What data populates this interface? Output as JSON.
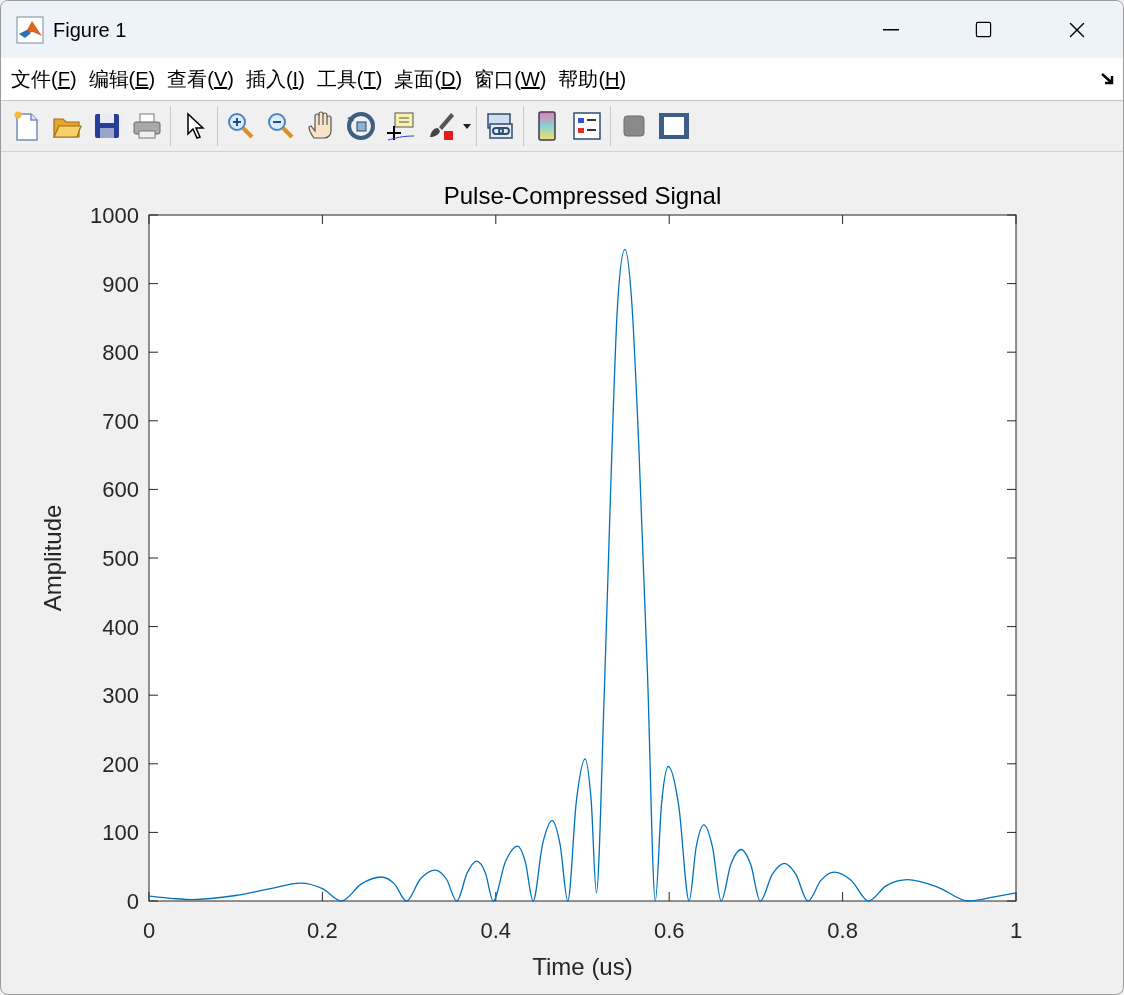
{
  "window": {
    "title": "Figure 1"
  },
  "menu": [
    {
      "label": "文件(F)"
    },
    {
      "label": "编辑(E)"
    },
    {
      "label": "查看(V)"
    },
    {
      "label": "插入(I)"
    },
    {
      "label": "工具(T)"
    },
    {
      "label": "桌面(D)"
    },
    {
      "label": "窗口(W)"
    },
    {
      "label": "帮助(H)"
    }
  ],
  "plot": {
    "chart_data": {
      "type": "line",
      "title": "Pulse-Compressed Signal",
      "xlabel": "Time (us)",
      "ylabel": "Amplitude",
      "xlim": [
        0,
        1
      ],
      "ylim": [
        0,
        1000
      ],
      "xticks": [
        {
          "value": 0,
          "label": "0"
        },
        {
          "value": 0.2,
          "label": "0.2"
        },
        {
          "value": 0.4,
          "label": "0.4"
        },
        {
          "value": 0.6,
          "label": "0.6"
        },
        {
          "value": 0.8,
          "label": "0.8"
        },
        {
          "value": 1,
          "label": "1"
        }
      ],
      "yticks": [
        {
          "value": 0,
          "label": "0"
        },
        {
          "value": 100,
          "label": "100"
        },
        {
          "value": 200,
          "label": "200"
        },
        {
          "value": 300,
          "label": "300"
        },
        {
          "value": 400,
          "label": "400"
        },
        {
          "value": 500,
          "label": "500"
        },
        {
          "value": 600,
          "label": "600"
        },
        {
          "value": 700,
          "label": "700"
        },
        {
          "value": 800,
          "label": "800"
        },
        {
          "value": 900,
          "label": "900"
        },
        {
          "value": 1000,
          "label": "1000"
        }
      ],
      "x": [
        0,
        0.025,
        0.05,
        0.1,
        0.14,
        0.175,
        0.2,
        0.222,
        0.245,
        0.268,
        0.283,
        0.297,
        0.313,
        0.33,
        0.343,
        0.355,
        0.367,
        0.378,
        0.388,
        0.397,
        0.411,
        0.425,
        0.434,
        0.443,
        0.454,
        0.465,
        0.474,
        0.483,
        0.493,
        0.503,
        0.51,
        0.516,
        0.525,
        0.533,
        0.54,
        0.549,
        0.557,
        0.565,
        0.575,
        0.584,
        0.591,
        0.599,
        0.611,
        0.623,
        0.631,
        0.64,
        0.65,
        0.66,
        0.671,
        0.683,
        0.694,
        0.705,
        0.719,
        0.733,
        0.746,
        0.76,
        0.775,
        0.79,
        0.81,
        0.83,
        0.85,
        0.875,
        0.91,
        0.945,
        0.975,
        1
      ],
      "series": [
        {
          "color": "#0072bd",
          "values": [
            7,
            4,
            2,
            8,
            18,
            26,
            18,
            0,
            25,
            35,
            25,
            0,
            32,
            45,
            32,
            0,
            41,
            58,
            41,
            0,
            57,
            80,
            57,
            0,
            83,
            117,
            83,
            0,
            146,
            207,
            146,
            12,
            300,
            620,
            860,
            950,
            870,
            660,
            330,
            0,
            139,
            196,
            139,
            0,
            78,
            111,
            78,
            0,
            53,
            75,
            53,
            0,
            39,
            55,
            39,
            0,
            30,
            42,
            30,
            0,
            22,
            31,
            20,
            0,
            6,
            12
          ]
        }
      ]
    }
  }
}
